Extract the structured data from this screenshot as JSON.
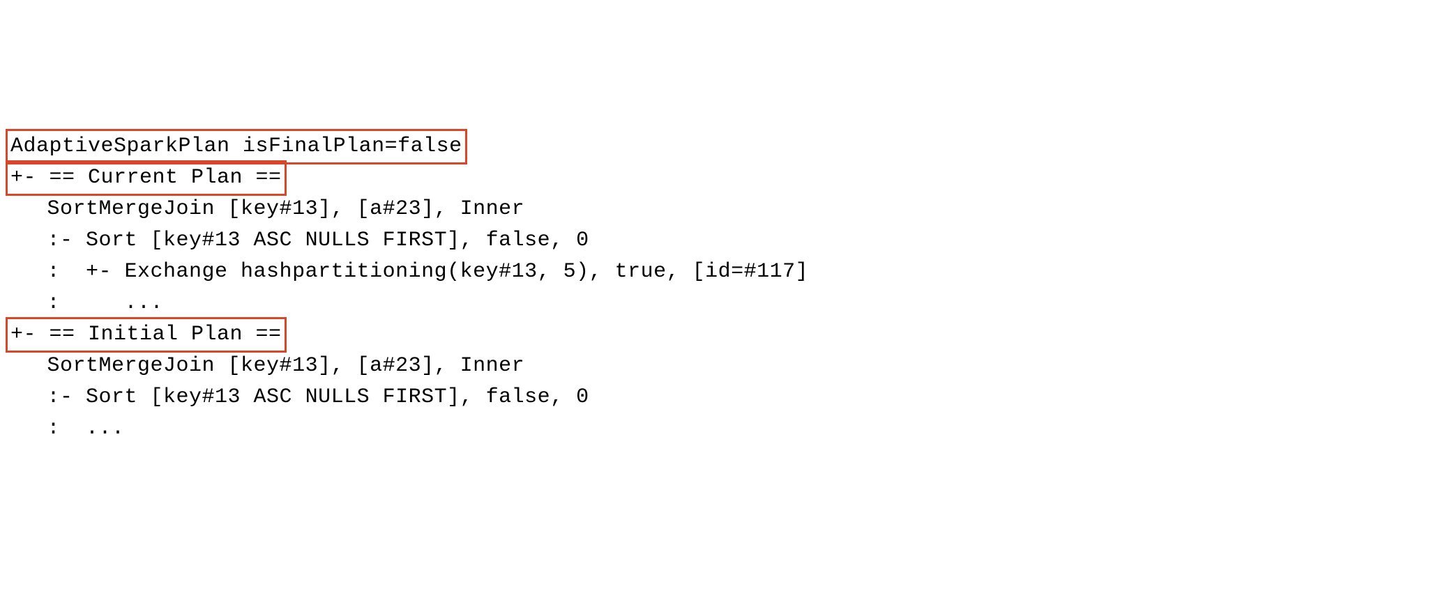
{
  "highlight_color": "#d9472b",
  "lines": {
    "l1": "AdaptiveSparkPlan isFinalPlan=false",
    "l2": "+- == Current Plan ==",
    "l3": "   SortMergeJoin [key#13], [a#23], Inner",
    "l4": "   :- Sort [key#13 ASC NULLS FIRST], false, 0",
    "l5": "   :  +- Exchange hashpartitioning(key#13, 5), true, [id=#117]",
    "l6": "   :     ...",
    "l7": "+- == Initial Plan ==",
    "l8": "   SortMergeJoin [key#13], [a#23], Inner",
    "l9": "   :- Sort [key#13 ASC NULLS FIRST], false, 0",
    "l10": "   :  ..."
  }
}
